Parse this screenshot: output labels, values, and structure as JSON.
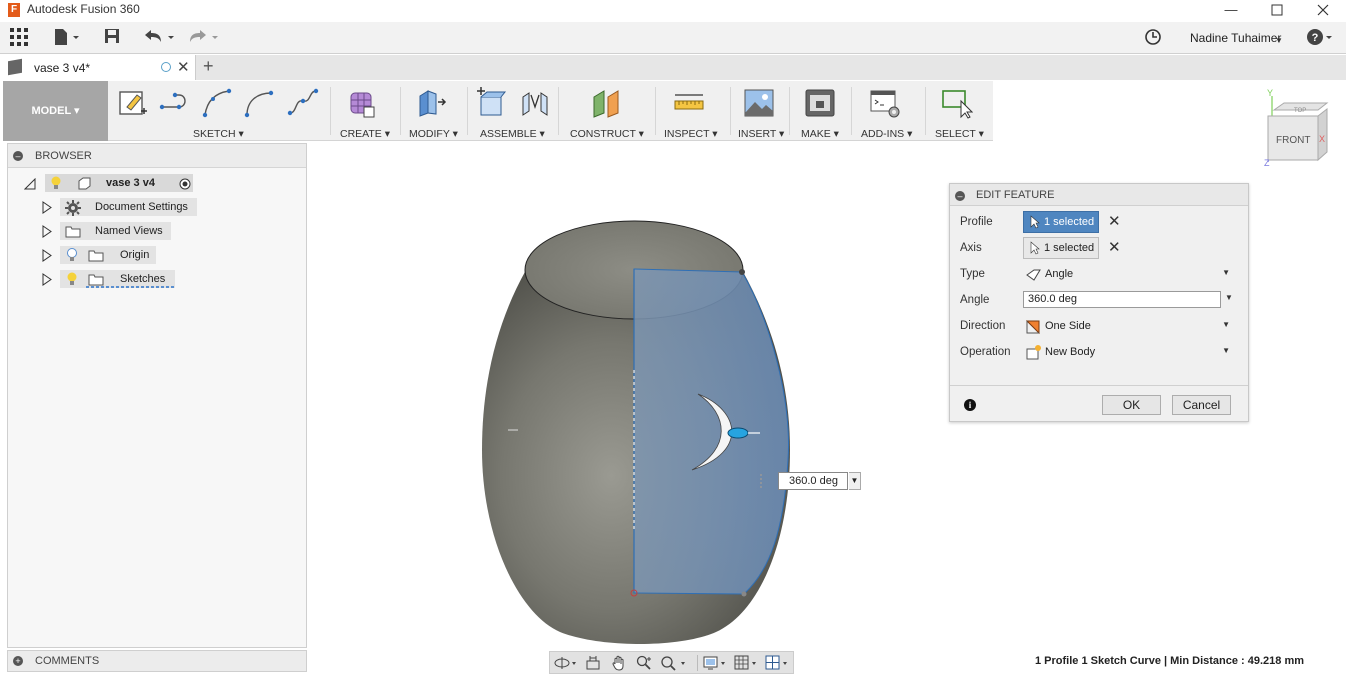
{
  "window": {
    "title": "Autodesk Fusion 360",
    "app_letter": "F",
    "controls": [
      "minimize-icon",
      "maximize-icon",
      "close-icon"
    ]
  },
  "toolbar": {
    "user_name": "Nadine Tuhaimer",
    "icons": [
      "grid-menu-icon",
      "file-icon",
      "save-icon",
      "undo-icon",
      "redo-icon",
      "job-status-icon",
      "help-icon"
    ]
  },
  "document_tab": {
    "name": "vase 3 v4*",
    "close_symbol": "✕",
    "new_tab_symbol": "+"
  },
  "ribbon": {
    "workspace": "MODEL",
    "groups": [
      {
        "label": "SKETCH"
      },
      {
        "label": "CREATE"
      },
      {
        "label": "MODIFY"
      },
      {
        "label": "ASSEMBLE"
      },
      {
        "label": "CONSTRUCT"
      },
      {
        "label": "INSPECT"
      },
      {
        "label": "INSERT"
      },
      {
        "label": "MAKE"
      },
      {
        "label": "ADD-INS"
      },
      {
        "label": "SELECT"
      }
    ]
  },
  "viewcube": {
    "face": "FRONT",
    "top_face": "TOP",
    "axis_y": "Y",
    "axis_x": "X",
    "axis_z": "Z"
  },
  "browser": {
    "title": "BROWSER",
    "root": "vase 3 v4",
    "items": [
      {
        "label": "Document Settings",
        "icon": "gear-icon"
      },
      {
        "label": "Named Views",
        "icon": "folder-icon"
      },
      {
        "label": "Origin",
        "icon": "folder-icon",
        "visibility": "lightbulb-off"
      },
      {
        "label": "Sketches",
        "icon": "folder-icon",
        "visibility": "lightbulb-on"
      }
    ]
  },
  "comments": {
    "title": "COMMENTS"
  },
  "edit_feature": {
    "title": "EDIT FEATURE",
    "rows": {
      "profile": {
        "label": "Profile",
        "value": "1 selected"
      },
      "axis": {
        "label": "Axis",
        "value": "1 selected"
      },
      "type": {
        "label": "Type",
        "value": "Angle"
      },
      "angle": {
        "label": "Angle",
        "value": "360.0 deg"
      },
      "direction": {
        "label": "Direction",
        "value": "One Side"
      },
      "operation": {
        "label": "Operation",
        "value": "New Body"
      }
    },
    "ok_label": "OK",
    "cancel_label": "Cancel",
    "info_symbol": "i"
  },
  "canvas": {
    "angle_input": "360.0 deg",
    "colors": {
      "body": "#7a7a72",
      "profile": "#5b86b8",
      "selection": "#2f6fb5"
    }
  },
  "navbar": {
    "icons": [
      "orbit-icon",
      "look-at-icon",
      "pan-icon",
      "zoom-icon",
      "fit-icon",
      "display-settings-icon",
      "grid-icon",
      "viewports-icon"
    ]
  },
  "status": {
    "text": "1 Profile 1 Sketch Curve | Min Distance : 49.218 mm"
  }
}
